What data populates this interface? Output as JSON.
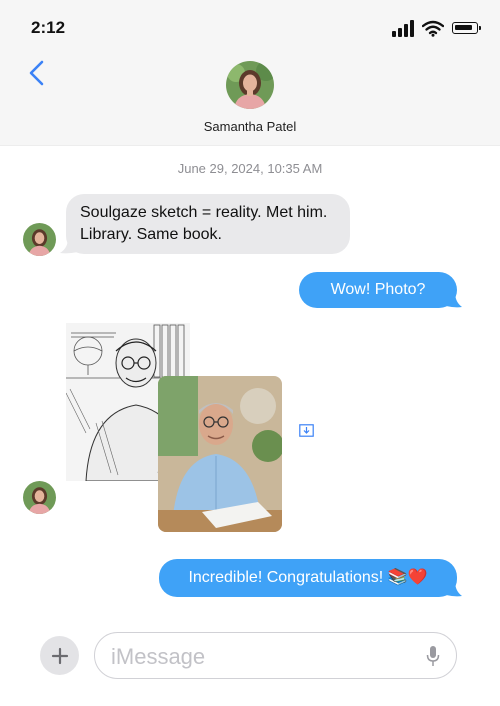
{
  "status_bar": {
    "time": "2:12"
  },
  "header": {
    "contact_name": "Samantha Patel"
  },
  "conversation": {
    "timestamp": "June 29, 2024, 10:35 AM",
    "messages": [
      {
        "direction": "incoming",
        "text": "Soulgaze sketch = reality. Met him. Library. Same book."
      },
      {
        "direction": "outgoing",
        "text": "Wow! Photo?"
      },
      {
        "direction": "incoming",
        "type": "images",
        "items": [
          "pencil sketch of an older man with glasses",
          "photo of an older man with glasses at a desk"
        ]
      },
      {
        "direction": "outgoing",
        "text": "Incredible! Congratulations! 📚❤️"
      }
    ]
  },
  "composer": {
    "placeholder": "iMessage"
  },
  "colors": {
    "outgoing_bubble": "#3fa2f7",
    "incoming_bubble": "#e9e9eb",
    "accent": "#3b82f6"
  }
}
